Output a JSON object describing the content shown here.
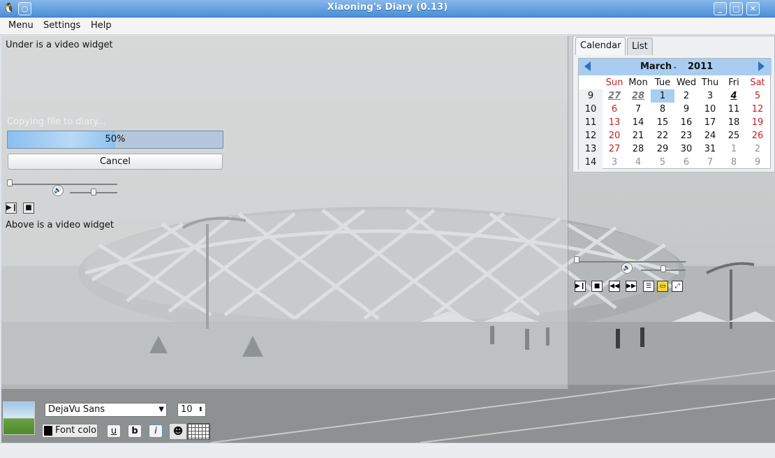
{
  "window": {
    "title": "Xiaoning's Diary (0.13)"
  },
  "menu": {
    "items": [
      {
        "label": "Menu"
      },
      {
        "label": "Settings"
      },
      {
        "label": "Help"
      }
    ]
  },
  "video_panel": {
    "top_label": "Under is a video widget",
    "copy_status": "Copying file to diary...",
    "progress": {
      "value": 0.5,
      "label": "50%"
    },
    "cancel_label": "Cancel",
    "bottom_label": "Above is a video widget",
    "seek_position": 0,
    "volume_level": 0.5
  },
  "calendar": {
    "tabs": [
      {
        "label": "Calendar"
      },
      {
        "label": "List"
      }
    ],
    "active_tab": "Calendar",
    "month": "March",
    "year": "2011",
    "weekdays": [
      "Sun",
      "Mon",
      "Tue",
      "Wed",
      "Thu",
      "Fri",
      "Sat"
    ],
    "weeks": [
      {
        "num": "9",
        "days": [
          "27",
          "28",
          "1",
          "2",
          "3",
          "4",
          "5"
        ]
      },
      {
        "num": "10",
        "days": [
          "6",
          "7",
          "8",
          "9",
          "10",
          "11",
          "12"
        ]
      },
      {
        "num": "11",
        "days": [
          "13",
          "14",
          "15",
          "16",
          "17",
          "18",
          "19"
        ]
      },
      {
        "num": "12",
        "days": [
          "20",
          "21",
          "22",
          "23",
          "24",
          "25",
          "26"
        ]
      },
      {
        "num": "13",
        "days": [
          "27",
          "28",
          "29",
          "30",
          "31",
          "1",
          "2"
        ]
      },
      {
        "num": "14",
        "days": [
          "3",
          "4",
          "5",
          "6",
          "7",
          "8",
          "9"
        ]
      }
    ],
    "selected_day": "1",
    "today": "4",
    "colors": {
      "header": "#a9cdf1",
      "weekend": "#c42020",
      "arrow": "#2f6fc0"
    }
  },
  "right_video": {
    "seek_position": 0,
    "volume_level": 0.5,
    "controls": [
      "play-pause-icon",
      "stop-icon",
      "rewind-icon",
      "fast-forward-icon",
      "playlist-icon",
      "open-folder-icon",
      "fullscreen-icon"
    ]
  },
  "toolbar": {
    "font_family": "DejaVu Sans",
    "font_size": "10",
    "font_color_label": "Font color",
    "underline_label": "u",
    "bold_label": "b",
    "italic_label": "i"
  }
}
